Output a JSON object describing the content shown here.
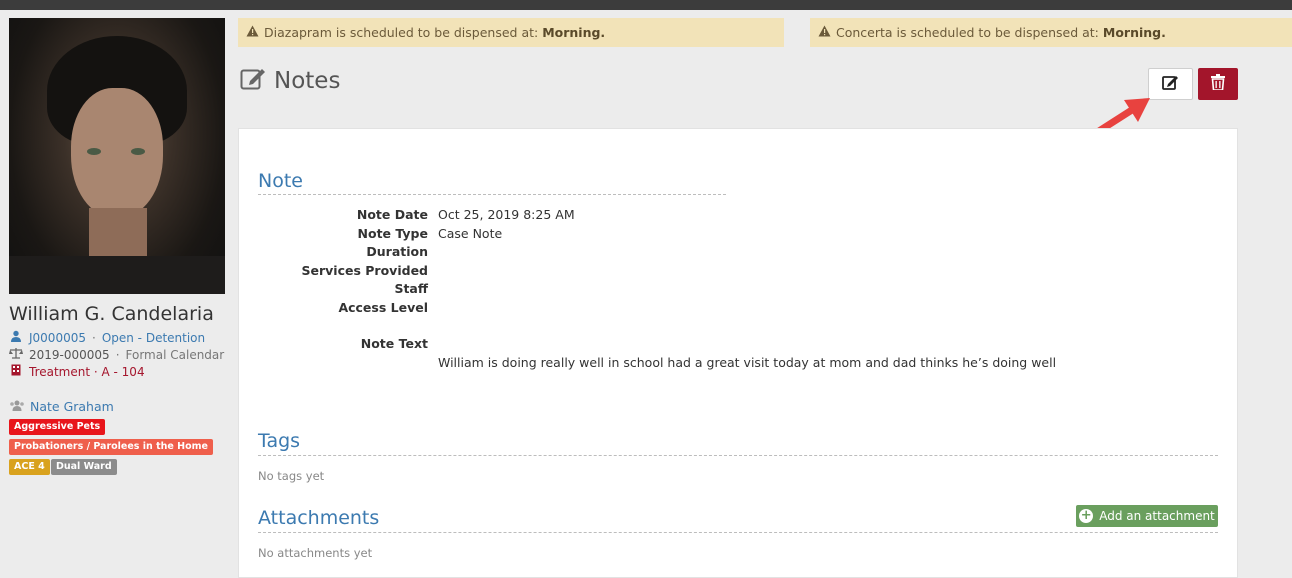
{
  "profile": {
    "name": "William G. Candelaria",
    "case_id": "J0000005",
    "case_status": "Open - Detention",
    "docket_no": "2019-000005",
    "calendar": "Formal Calendar",
    "placement": "Treatment · A - 104",
    "worker": "Nate Graham",
    "badges": [
      {
        "label": "Aggressive Pets",
        "color": "#e8151b"
      },
      {
        "label": "Probationers / Parolees in the Home",
        "color": "#ef5f4c"
      },
      {
        "label": "ACE 4",
        "color": "#d9a21e"
      },
      {
        "label": "Dual Ward",
        "color": "#8c8c8c"
      }
    ]
  },
  "alerts": [
    {
      "text": "Diazapram is scheduled to be dispensed at: ",
      "time": "Morning."
    },
    {
      "text": "Concerta is scheduled to be dispensed at: ",
      "time": "Morning."
    }
  ],
  "header": {
    "title": "Notes"
  },
  "note": {
    "section_title": "Note",
    "fields": [
      {
        "label": "Note Date",
        "value": "Oct 25, 2019 8:25 AM"
      },
      {
        "label": "Note Type",
        "value": "Case Note"
      },
      {
        "label": "Duration",
        "value": ""
      },
      {
        "label": "Services Provided",
        "value": ""
      },
      {
        "label": "Staff",
        "value": ""
      },
      {
        "label": "Access Level",
        "value": ""
      }
    ],
    "text_label": "Note Text",
    "text_value": "William is doing really well in school had a great visit today at mom and dad thinks he’s doing well"
  },
  "tags": {
    "title": "Tags",
    "empty": "No tags yet"
  },
  "attachments": {
    "title": "Attachments",
    "empty": "No attachments yet",
    "add_label": "Add an attachment"
  },
  "colors": {
    "accent": "#3c7ab0",
    "danger": "#a3152b",
    "success": "#6a9f5e",
    "alert_bg": "#f2e3b8",
    "annotation_arrow": "#e8423f"
  }
}
